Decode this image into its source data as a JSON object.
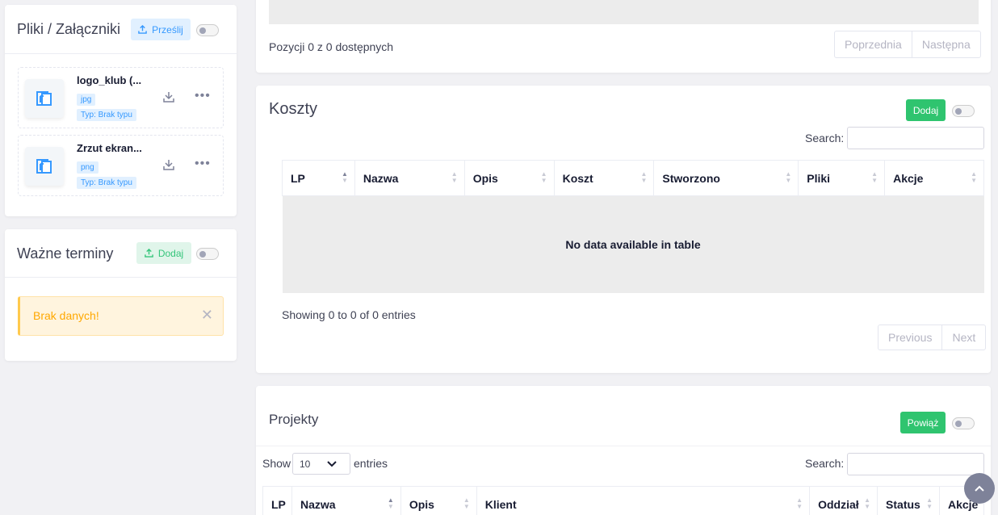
{
  "files_panel": {
    "title": "Pliki / Załączniki",
    "upload_label": "Prześlij",
    "files": [
      {
        "name": "logo_klub (...",
        "ext": "jpg",
        "type": "Typ: Brak typu"
      },
      {
        "name": "Zrzut ekran...",
        "ext": "png",
        "type": "Typ: Brak typu"
      }
    ]
  },
  "deadlines_panel": {
    "title": "Ważne terminy",
    "add_label": "Dodaj",
    "alert_text": "Brak danych!"
  },
  "top_section": {
    "info": "Pozycji 0 z 0 dostępnych",
    "prev_label": "Poprzednia",
    "next_label": "Następna"
  },
  "costs": {
    "title": "Koszty",
    "add_label": "Dodaj",
    "search_label": "Search:",
    "columns": [
      "LP",
      "Nazwa",
      "Opis",
      "Koszt",
      "Stworzono",
      "Pliki",
      "Akcje"
    ],
    "empty_text": "No data available in table",
    "info": "Showing 0 to 0 of 0 entries",
    "prev_label": "Previous",
    "next_label": "Next"
  },
  "projects": {
    "title": "Projekty",
    "link_label": "Powiąż",
    "show_label": "Show",
    "page_size": "10",
    "entries_label": "entries",
    "search_label": "Search:",
    "columns": [
      "LP",
      "Nazwa",
      "Opis",
      "Klient",
      "Oddział",
      "Status",
      "Akcje"
    ]
  },
  "colors": {
    "primary": "#3699ff",
    "success": "#2fc46f",
    "warning_bg": "#fff4de",
    "warning_text": "#ffa800"
  }
}
